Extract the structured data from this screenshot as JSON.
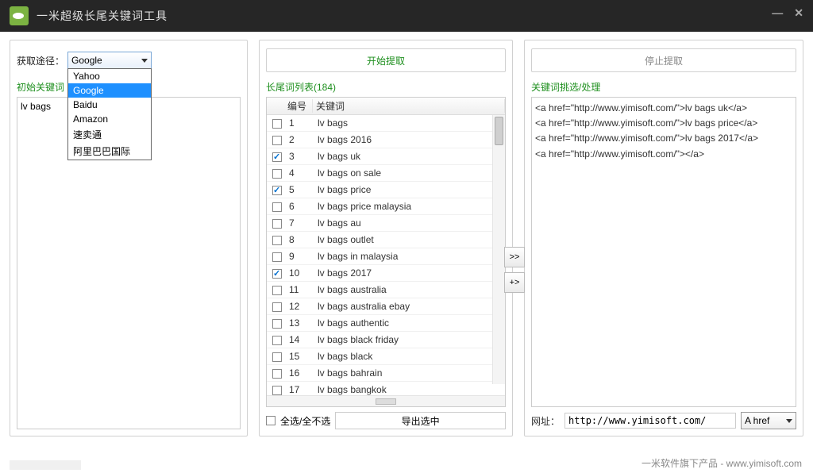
{
  "app": {
    "title": "一米超级长尾关键词工具"
  },
  "window": {
    "min": "—",
    "close": "✕"
  },
  "source": {
    "label": "获取途径：",
    "selected": "Google",
    "options": [
      "Yahoo",
      "Google",
      "Baidu",
      "Amazon",
      "速卖通",
      "阿里巴巴国际"
    ]
  },
  "buttons": {
    "start": "开始提取",
    "stop": "停止提取",
    "select_all_label": "全选/全不选",
    "export_selected": "导出选中"
  },
  "seed": {
    "label": "初始关键词",
    "value": "lv bags"
  },
  "list": {
    "label": "长尾词列表(184)",
    "headers": {
      "no": "编号",
      "kw": "关键词"
    },
    "rows": [
      {
        "no": "1",
        "kw": "lv bags",
        "checked": false
      },
      {
        "no": "2",
        "kw": "lv bags 2016",
        "checked": false
      },
      {
        "no": "3",
        "kw": "lv bags uk",
        "checked": true
      },
      {
        "no": "4",
        "kw": "lv bags on sale",
        "checked": false
      },
      {
        "no": "5",
        "kw": "lv bags price",
        "checked": true
      },
      {
        "no": "6",
        "kw": "lv bags price malaysia",
        "checked": false
      },
      {
        "no": "7",
        "kw": "lv bags au",
        "checked": false
      },
      {
        "no": "8",
        "kw": "lv bags outlet",
        "checked": false
      },
      {
        "no": "9",
        "kw": "lv bags in malaysia",
        "checked": false
      },
      {
        "no": "10",
        "kw": "lv bags 2017",
        "checked": true
      },
      {
        "no": "11",
        "kw": "lv bags australia",
        "checked": false
      },
      {
        "no": "12",
        "kw": "lv bags australia ebay",
        "checked": false
      },
      {
        "no": "13",
        "kw": "lv bags authentic",
        "checked": false
      },
      {
        "no": "14",
        "kw": "lv bags black friday",
        "checked": false
      },
      {
        "no": "15",
        "kw": "lv bags black",
        "checked": false
      },
      {
        "no": "16",
        "kw": "lv bags bahrain",
        "checked": false
      },
      {
        "no": "17",
        "kw": "lv bags bangkok",
        "checked": false
      }
    ]
  },
  "transfer": {
    "all": ">>",
    "add": "+>"
  },
  "result": {
    "label": "关键词挑选/处理",
    "text": "<a href=\"http://www.yimisoft.com/\">lv bags uk</a>\n<a href=\"http://www.yimisoft.com/\">lv bags price</a>\n<a href=\"http://www.yimisoft.com/\">lv bags 2017</a>\n<a href=\"http://www.yimisoft.com/\"></a>"
  },
  "url": {
    "label": "网址：",
    "value": "http://www.yimisoft.com/"
  },
  "format": {
    "selected": "A href"
  },
  "footer": {
    "text": "一米软件旗下产品 - ",
    "link": "www.yimisoft.com"
  }
}
